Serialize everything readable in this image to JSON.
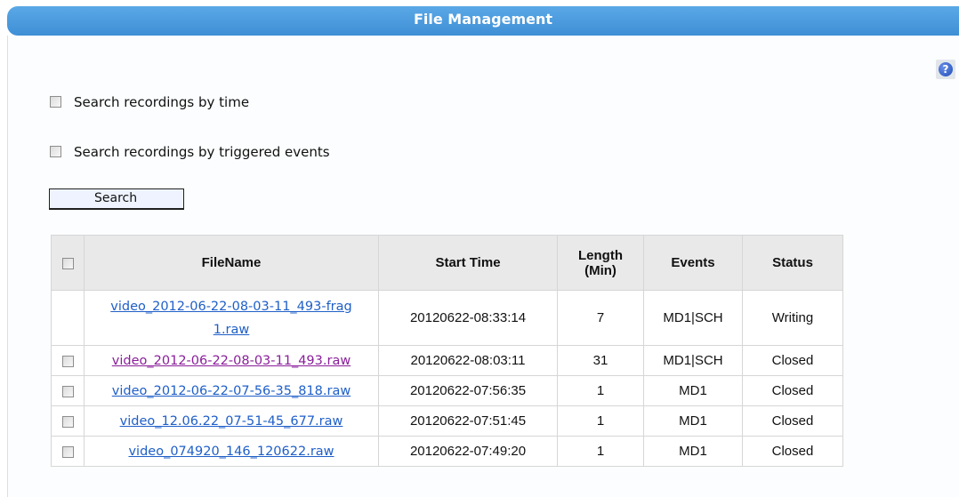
{
  "header": {
    "title": "File Management"
  },
  "help": {
    "icon": "help-icon",
    "glyph": "?"
  },
  "search_options": {
    "by_time_label": "Search recordings by time",
    "by_time_checked": false,
    "by_events_label": "Search recordings by triggered events",
    "by_events_checked": false
  },
  "search_button": {
    "label": "Search"
  },
  "table": {
    "columns": {
      "filename": "FileName",
      "start_time": "Start Time",
      "length_line1": "Length",
      "length_line2": "(Min)",
      "events": "Events",
      "status": "Status"
    },
    "rows": [
      {
        "has_checkbox": false,
        "filename_line1": "video_2012-06-22-08-03-11_493-frag",
        "filename_line2": "1.raw",
        "start_time": "20120622-08:33:14",
        "length": "7",
        "events": "MD1|SCH",
        "status": "Writing"
      },
      {
        "has_checkbox": true,
        "filename": "video_2012-06-22-08-03-11_493.raw",
        "visited": true,
        "start_time": "20120622-08:03:11",
        "length": "31",
        "events": "MD1|SCH",
        "status": "Closed"
      },
      {
        "has_checkbox": true,
        "filename": "video_2012-06-22-07-56-35_818.raw",
        "start_time": "20120622-07:56:35",
        "length": "1",
        "events": "MD1",
        "status": "Closed"
      },
      {
        "has_checkbox": true,
        "filename": "video_12.06.22_07-51-45_677.raw",
        "start_time": "20120622-07:51:45",
        "length": "1",
        "events": "MD1",
        "status": "Closed"
      },
      {
        "has_checkbox": true,
        "filename": "video_074920_146_120622.raw",
        "start_time": "20120622-07:49:20",
        "length": "1",
        "events": "MD1",
        "status": "Closed"
      }
    ]
  },
  "colors": {
    "header_blue": "#4a9ae0",
    "link": "#1f5fc8",
    "visited_link": "#8a1e9b"
  }
}
